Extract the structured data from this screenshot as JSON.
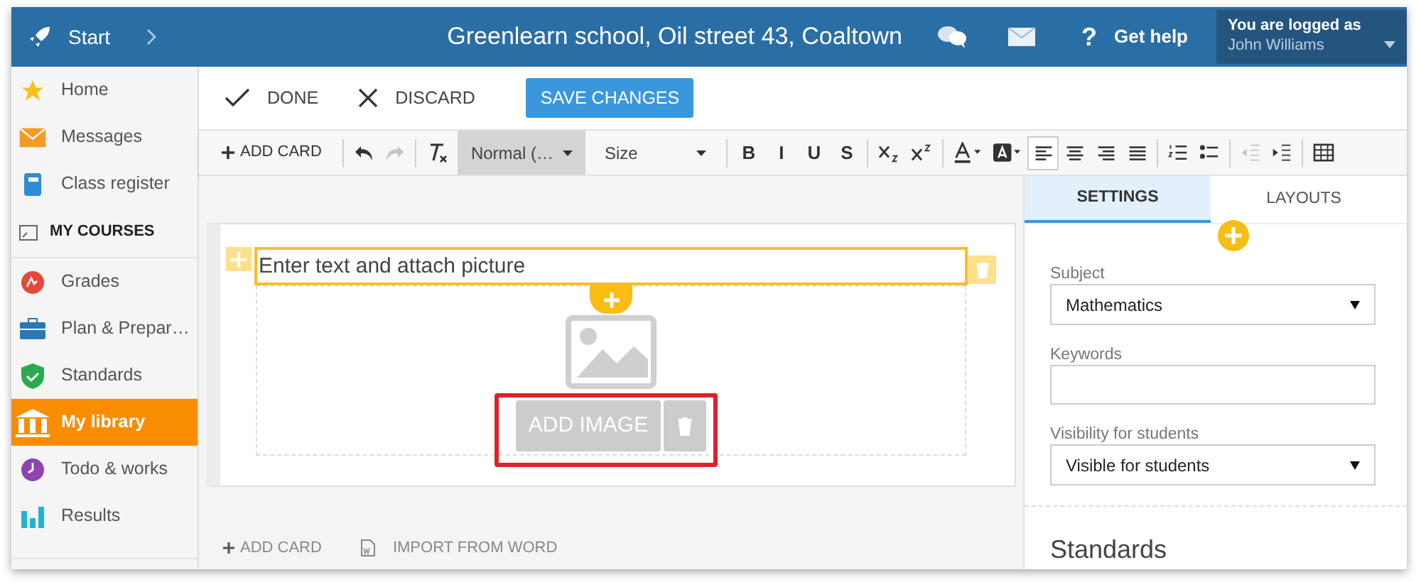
{
  "header": {
    "start": "Start",
    "school": "Greenlearn school, Oil street 43, Coaltown",
    "help_mark": "?",
    "help": "Get help",
    "login_caption": "You are logged as",
    "user": "John Williams"
  },
  "sidebar": {
    "items": [
      {
        "label": "Home",
        "selected": false
      },
      {
        "label": "Messages",
        "selected": false
      },
      {
        "label": "Class register",
        "selected": false
      }
    ],
    "courses_heading": "MY COURSES",
    "course_items": [
      {
        "label": "Grades",
        "selected": false
      },
      {
        "label": "Plan & Prepar…",
        "selected": false
      },
      {
        "label": "Standards",
        "selected": false
      },
      {
        "label": "My library",
        "selected": true
      },
      {
        "label": "Todo & works",
        "selected": false
      },
      {
        "label": "Results",
        "selected": false
      }
    ]
  },
  "actions": {
    "done": "DONE",
    "discard": "DISCARD",
    "save": "SAVE CHANGES"
  },
  "toolbar": {
    "add_card": "ADD CARD",
    "groups": [
      [
        {
          "kind": "undo",
          "disabled": false,
          "selected": false
        },
        {
          "kind": "redo",
          "disabled": true,
          "selected": false
        }
      ],
      [
        {
          "kind": "clear",
          "disabled": false,
          "selected": false
        },
        {
          "kind": "dropdown",
          "label": "Normal (…",
          "disabled": false,
          "selected": true
        },
        {
          "kind": "dropdown",
          "label": "Size",
          "disabled": false,
          "selected": false
        }
      ],
      [
        {
          "kind": "letter",
          "label": "B",
          "disabled": false,
          "selected": false
        },
        {
          "kind": "letter",
          "label": "I",
          "disabled": false,
          "selected": false
        },
        {
          "kind": "letter",
          "label": "U",
          "disabled": false,
          "selected": false
        },
        {
          "kind": "letter",
          "label": "S",
          "disabled": false,
          "selected": false
        }
      ],
      [
        {
          "kind": "subscript",
          "disabled": false,
          "selected": false
        },
        {
          "kind": "superscript",
          "disabled": false,
          "selected": false
        }
      ],
      [
        {
          "kind": "text-color",
          "disabled": false,
          "selected": false
        },
        {
          "kind": "bg-color",
          "disabled": false,
          "selected": false
        },
        {
          "kind": "align-left",
          "disabled": false,
          "selected": true
        },
        {
          "kind": "align-center",
          "disabled": false,
          "selected": false
        },
        {
          "kind": "align-right",
          "disabled": false,
          "selected": false
        },
        {
          "kind": "justify",
          "disabled": false,
          "selected": false
        }
      ],
      [
        {
          "kind": "ordered-list",
          "disabled": false,
          "selected": false
        },
        {
          "kind": "bullet-list",
          "disabled": false,
          "selected": false
        }
      ],
      [
        {
          "kind": "outdent",
          "disabled": true,
          "selected": false
        },
        {
          "kind": "indent",
          "disabled": false,
          "selected": false
        }
      ],
      [
        {
          "kind": "table",
          "disabled": false,
          "selected": false
        }
      ]
    ]
  },
  "editor": {
    "placeholder": "Enter text and attach picture",
    "add_image": "ADD IMAGE",
    "highlighted": true
  },
  "footer": {
    "add_card": "ADD CARD",
    "import": "IMPORT FROM WORD"
  },
  "panel": {
    "tabs": [
      {
        "label": "SETTINGS",
        "selected": true
      },
      {
        "label": "LAYOUTS",
        "selected": false
      }
    ],
    "fields": [
      {
        "kind": "select",
        "label": "Subject",
        "value": "Mathematics"
      },
      {
        "kind": "text",
        "label": "Keywords"
      },
      {
        "kind": "select",
        "label": "Visibility for students",
        "value": "Visible for students"
      }
    ],
    "section": "Standards"
  }
}
